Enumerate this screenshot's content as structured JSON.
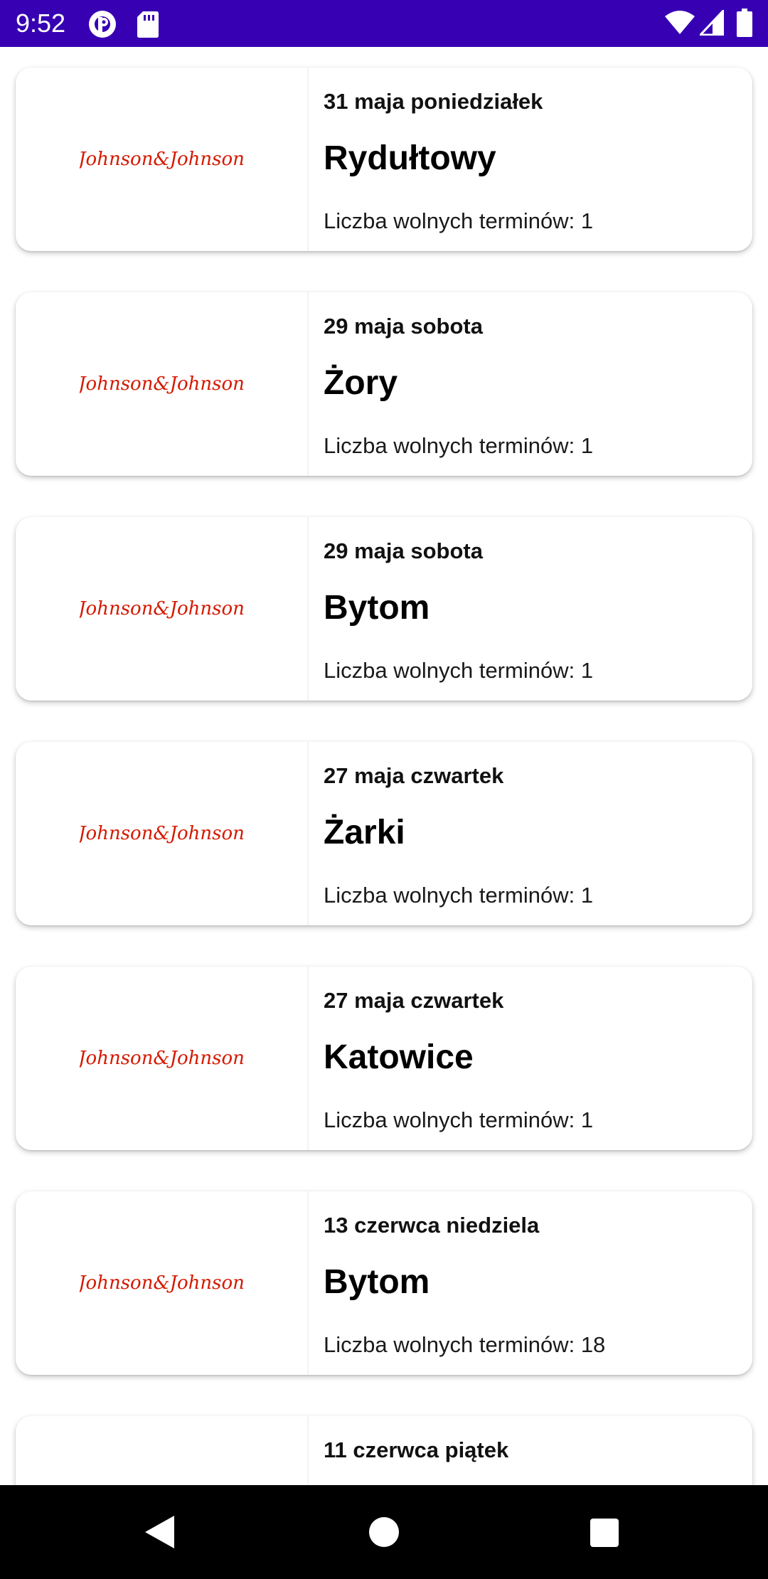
{
  "status_bar": {
    "time": "9:52",
    "background": "#3700B3",
    "icons": [
      "pocket-casts-icon",
      "sd-card-icon",
      "wifi-icon",
      "cellular-signal-icon",
      "battery-icon"
    ]
  },
  "logo": {
    "text": "Johnson&Johnson",
    "color": "#D51900"
  },
  "appointments": [
    {
      "date": "31 maja poniedziałek",
      "city": "Rydułtowy",
      "slots": "Liczba wolnych terminów: 1"
    },
    {
      "date": "29 maja sobota",
      "city": "Żory",
      "slots": "Liczba wolnych terminów: 1"
    },
    {
      "date": "29 maja sobota",
      "city": "Bytom",
      "slots": "Liczba wolnych terminów: 1"
    },
    {
      "date": "27 maja czwartek",
      "city": "Żarki",
      "slots": "Liczba wolnych terminów: 1"
    },
    {
      "date": "27 maja czwartek",
      "city": "Katowice",
      "slots": "Liczba wolnych terminów: 1"
    },
    {
      "date": "13 czerwca niedziela",
      "city": "Bytom",
      "slots": "Liczba wolnych terminów: 18"
    },
    {
      "date": "11 czerwca piątek",
      "city": "",
      "slots": ""
    }
  ],
  "nav_bar": {
    "buttons": [
      "back-icon",
      "home-icon",
      "recents-icon"
    ]
  }
}
